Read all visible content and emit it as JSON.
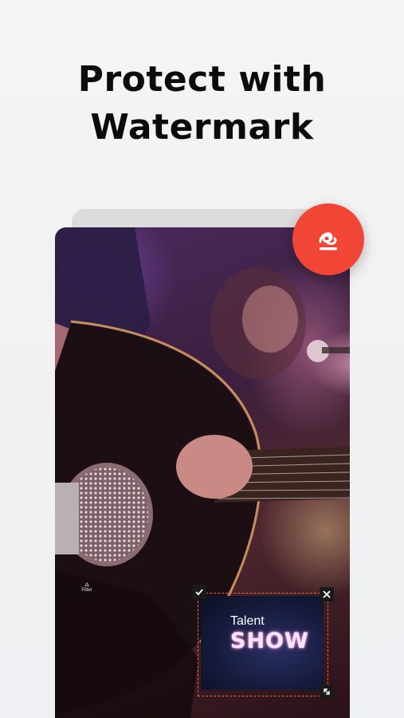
{
  "headline": {
    "line1": "Protect with",
    "line2": "Watermark"
  },
  "watermark": {
    "title": "Talent",
    "subtitle": "SHOW"
  },
  "fab": {
    "icon": "signature-icon",
    "color": "#f14635"
  },
  "tiny_control": {
    "icon": "filter-icon",
    "label": "Filter"
  },
  "handles": {
    "confirm_icon": "check-icon",
    "close_icon": "close-icon",
    "scale_icon": "resize-icon"
  }
}
